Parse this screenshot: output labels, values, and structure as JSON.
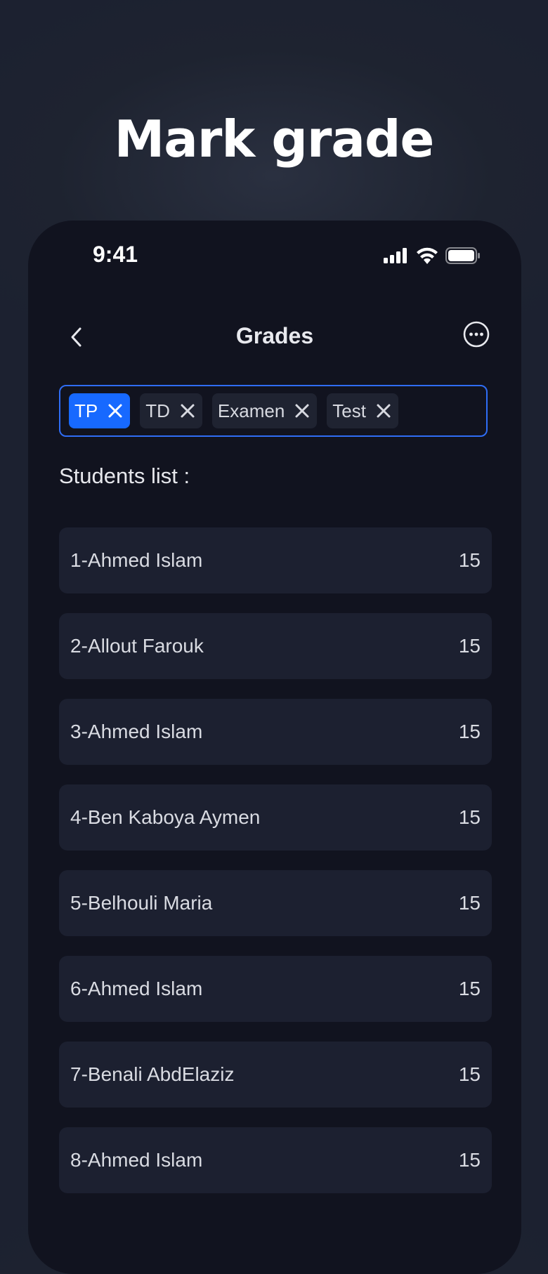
{
  "headline": "Mark grade",
  "status_bar": {
    "time": "9:41"
  },
  "nav": {
    "title": "Grades"
  },
  "tags": [
    {
      "label": "TP",
      "active": true
    },
    {
      "label": "TD",
      "active": false
    },
    {
      "label": "Examen",
      "active": false
    },
    {
      "label": "Test",
      "active": false
    }
  ],
  "section_title": "Students list :",
  "students": [
    {
      "name": "1-Ahmed Islam",
      "grade": "15"
    },
    {
      "name": "2-Allout Farouk",
      "grade": "15"
    },
    {
      "name": "3-Ahmed Islam",
      "grade": "15"
    },
    {
      "name": "4-Ben Kaboya Aymen",
      "grade": "15"
    },
    {
      "name": "5-Belhouli Maria",
      "grade": "15"
    },
    {
      "name": "6-Ahmed Islam",
      "grade": "15"
    },
    {
      "name": "7-Benali AbdElaziz",
      "grade": "15"
    },
    {
      "name": "8-Ahmed Islam",
      "grade": "15"
    }
  ],
  "colors": {
    "accent": "#1769ff",
    "background": "#1c2130",
    "card": "#11131f",
    "row": "#1c2030"
  }
}
